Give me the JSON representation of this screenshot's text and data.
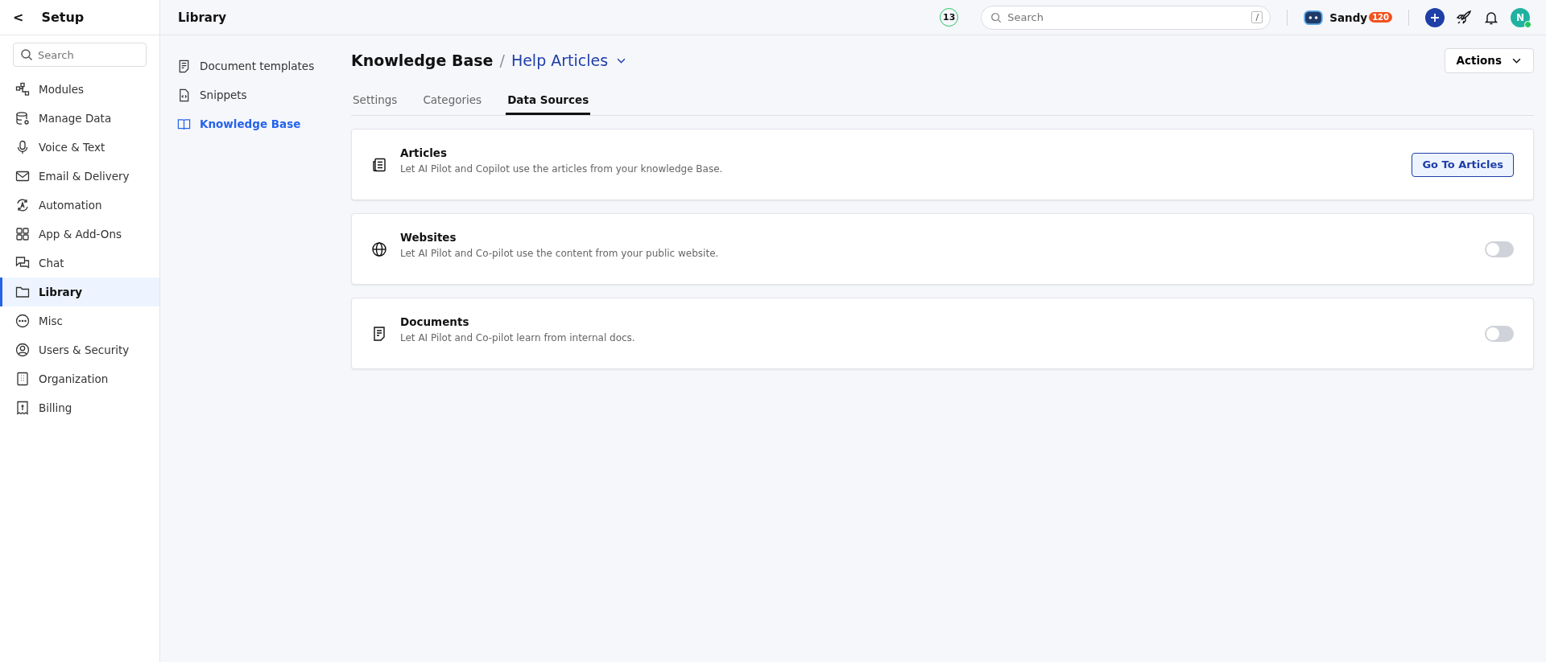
{
  "sidebar": {
    "back": "<",
    "title": "Setup",
    "search": {
      "placeholder": "Search"
    },
    "items": [
      {
        "label": "Modules",
        "selected": false
      },
      {
        "label": "Manage Data",
        "selected": false
      },
      {
        "label": "Voice & Text",
        "selected": false
      },
      {
        "label": "Email & Delivery",
        "selected": false
      },
      {
        "label": "Automation",
        "selected": false
      },
      {
        "label": "App & Add-Ons",
        "selected": false
      },
      {
        "label": "Chat",
        "selected": false
      },
      {
        "label": "Library",
        "selected": true
      },
      {
        "label": "Misc",
        "selected": false
      },
      {
        "label": "Users & Security",
        "selected": false
      },
      {
        "label": "Organization",
        "selected": false
      },
      {
        "label": "Billing",
        "selected": false
      }
    ]
  },
  "topbar": {
    "title": "Library",
    "count": "13",
    "search": {
      "placeholder": "Search",
      "shortcut": "/"
    },
    "user": "Sandy",
    "user_badge": "120",
    "avatar": "N",
    "online": true
  },
  "subnav": {
    "items": [
      {
        "label": "Document templates",
        "selected": false
      },
      {
        "label": "Snippets",
        "selected": false
      },
      {
        "label": "Knowledge Base",
        "selected": true
      }
    ]
  },
  "header": {
    "title": "Knowledge Base",
    "separator": "/",
    "subtitle": "Help Articles",
    "actions": "Actions"
  },
  "tabs": [
    {
      "label": "Settings",
      "selected": false
    },
    {
      "label": "Categories",
      "selected": false
    },
    {
      "label": "Data Sources",
      "selected": true
    }
  ],
  "sources": [
    {
      "kind": "button",
      "title": "Articles",
      "description": "Let AI Pilot and Copilot use the articles from your knowledge Base.",
      "button": "Go To Articles"
    },
    {
      "kind": "toggle",
      "title": "Websites",
      "description": "Let AI Pilot and Co-pilot use the content from your public website.",
      "on": false
    },
    {
      "kind": "toggle",
      "title": "Documents",
      "description": "Let AI Pilot and Co-pilot learn from internal docs.",
      "on": false
    }
  ]
}
